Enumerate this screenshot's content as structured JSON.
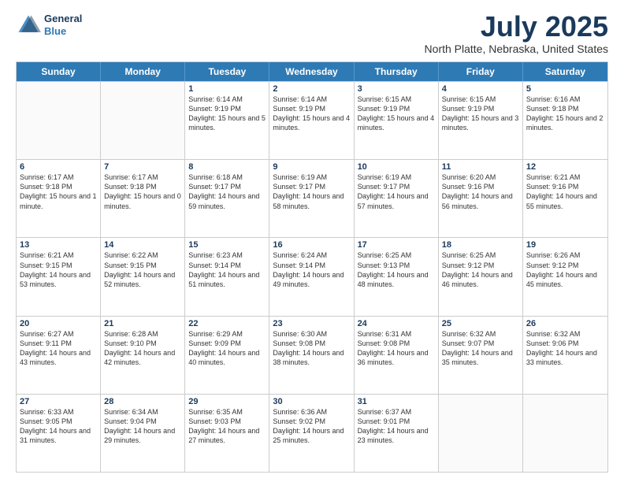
{
  "header": {
    "logo_line1": "General",
    "logo_line2": "Blue",
    "month_title": "July 2025",
    "location": "North Platte, Nebraska, United States"
  },
  "days_of_week": [
    "Sunday",
    "Monday",
    "Tuesday",
    "Wednesday",
    "Thursday",
    "Friday",
    "Saturday"
  ],
  "weeks": [
    [
      {
        "day": "",
        "info": ""
      },
      {
        "day": "",
        "info": ""
      },
      {
        "day": "1",
        "info": "Sunrise: 6:14 AM\nSunset: 9:19 PM\nDaylight: 15 hours and 5 minutes."
      },
      {
        "day": "2",
        "info": "Sunrise: 6:14 AM\nSunset: 9:19 PM\nDaylight: 15 hours and 4 minutes."
      },
      {
        "day": "3",
        "info": "Sunrise: 6:15 AM\nSunset: 9:19 PM\nDaylight: 15 hours and 4 minutes."
      },
      {
        "day": "4",
        "info": "Sunrise: 6:15 AM\nSunset: 9:19 PM\nDaylight: 15 hours and 3 minutes."
      },
      {
        "day": "5",
        "info": "Sunrise: 6:16 AM\nSunset: 9:18 PM\nDaylight: 15 hours and 2 minutes."
      }
    ],
    [
      {
        "day": "6",
        "info": "Sunrise: 6:17 AM\nSunset: 9:18 PM\nDaylight: 15 hours and 1 minute."
      },
      {
        "day": "7",
        "info": "Sunrise: 6:17 AM\nSunset: 9:18 PM\nDaylight: 15 hours and 0 minutes."
      },
      {
        "day": "8",
        "info": "Sunrise: 6:18 AM\nSunset: 9:17 PM\nDaylight: 14 hours and 59 minutes."
      },
      {
        "day": "9",
        "info": "Sunrise: 6:19 AM\nSunset: 9:17 PM\nDaylight: 14 hours and 58 minutes."
      },
      {
        "day": "10",
        "info": "Sunrise: 6:19 AM\nSunset: 9:17 PM\nDaylight: 14 hours and 57 minutes."
      },
      {
        "day": "11",
        "info": "Sunrise: 6:20 AM\nSunset: 9:16 PM\nDaylight: 14 hours and 56 minutes."
      },
      {
        "day": "12",
        "info": "Sunrise: 6:21 AM\nSunset: 9:16 PM\nDaylight: 14 hours and 55 minutes."
      }
    ],
    [
      {
        "day": "13",
        "info": "Sunrise: 6:21 AM\nSunset: 9:15 PM\nDaylight: 14 hours and 53 minutes."
      },
      {
        "day": "14",
        "info": "Sunrise: 6:22 AM\nSunset: 9:15 PM\nDaylight: 14 hours and 52 minutes."
      },
      {
        "day": "15",
        "info": "Sunrise: 6:23 AM\nSunset: 9:14 PM\nDaylight: 14 hours and 51 minutes."
      },
      {
        "day": "16",
        "info": "Sunrise: 6:24 AM\nSunset: 9:14 PM\nDaylight: 14 hours and 49 minutes."
      },
      {
        "day": "17",
        "info": "Sunrise: 6:25 AM\nSunset: 9:13 PM\nDaylight: 14 hours and 48 minutes."
      },
      {
        "day": "18",
        "info": "Sunrise: 6:25 AM\nSunset: 9:12 PM\nDaylight: 14 hours and 46 minutes."
      },
      {
        "day": "19",
        "info": "Sunrise: 6:26 AM\nSunset: 9:12 PM\nDaylight: 14 hours and 45 minutes."
      }
    ],
    [
      {
        "day": "20",
        "info": "Sunrise: 6:27 AM\nSunset: 9:11 PM\nDaylight: 14 hours and 43 minutes."
      },
      {
        "day": "21",
        "info": "Sunrise: 6:28 AM\nSunset: 9:10 PM\nDaylight: 14 hours and 42 minutes."
      },
      {
        "day": "22",
        "info": "Sunrise: 6:29 AM\nSunset: 9:09 PM\nDaylight: 14 hours and 40 minutes."
      },
      {
        "day": "23",
        "info": "Sunrise: 6:30 AM\nSunset: 9:08 PM\nDaylight: 14 hours and 38 minutes."
      },
      {
        "day": "24",
        "info": "Sunrise: 6:31 AM\nSunset: 9:08 PM\nDaylight: 14 hours and 36 minutes."
      },
      {
        "day": "25",
        "info": "Sunrise: 6:32 AM\nSunset: 9:07 PM\nDaylight: 14 hours and 35 minutes."
      },
      {
        "day": "26",
        "info": "Sunrise: 6:32 AM\nSunset: 9:06 PM\nDaylight: 14 hours and 33 minutes."
      }
    ],
    [
      {
        "day": "27",
        "info": "Sunrise: 6:33 AM\nSunset: 9:05 PM\nDaylight: 14 hours and 31 minutes."
      },
      {
        "day": "28",
        "info": "Sunrise: 6:34 AM\nSunset: 9:04 PM\nDaylight: 14 hours and 29 minutes."
      },
      {
        "day": "29",
        "info": "Sunrise: 6:35 AM\nSunset: 9:03 PM\nDaylight: 14 hours and 27 minutes."
      },
      {
        "day": "30",
        "info": "Sunrise: 6:36 AM\nSunset: 9:02 PM\nDaylight: 14 hours and 25 minutes."
      },
      {
        "day": "31",
        "info": "Sunrise: 6:37 AM\nSunset: 9:01 PM\nDaylight: 14 hours and 23 minutes."
      },
      {
        "day": "",
        "info": ""
      },
      {
        "day": "",
        "info": ""
      }
    ]
  ]
}
